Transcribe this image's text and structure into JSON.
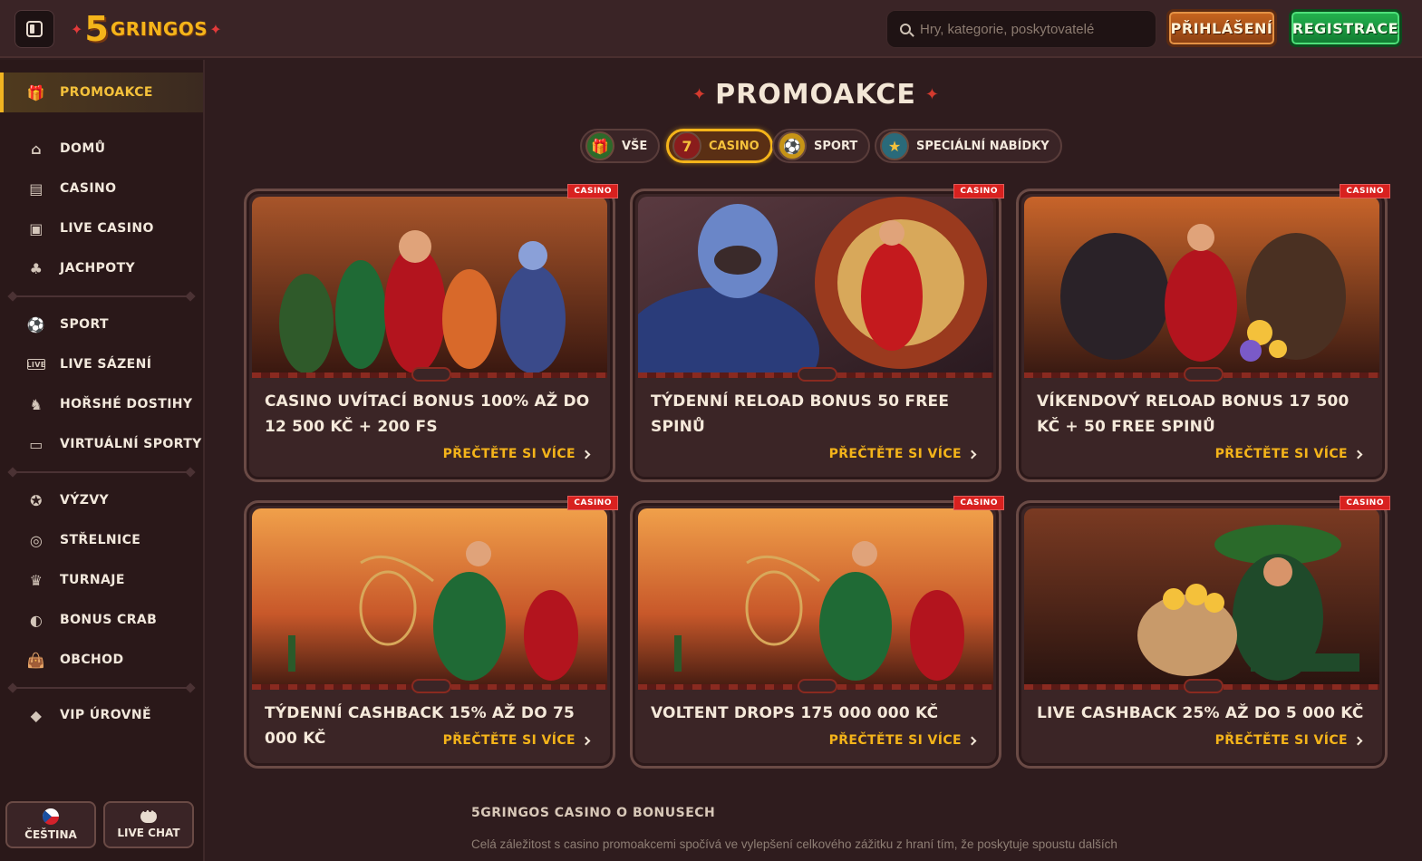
{
  "header": {
    "logo_five": "5",
    "logo_word": "GRINGOS",
    "search_placeholder": "Hry, kategorie, poskytovatelé",
    "login_label": "PŘIHLÁŠENÍ",
    "register_label": "REGISTRACE"
  },
  "sidebar": {
    "active": {
      "label": "PROMOAKCE",
      "icon": "gift-icon"
    },
    "group1": [
      {
        "label": "DOMŮ",
        "icon": "home-icon"
      },
      {
        "label": "CASINO",
        "icon": "slot-machine-icon"
      },
      {
        "label": "LIVE CASINO",
        "icon": "live-casino-icon"
      },
      {
        "label": "JACHPOTY",
        "icon": "clover-icon"
      }
    ],
    "group2": [
      {
        "label": "SPORT",
        "icon": "soccer-ball-icon"
      },
      {
        "label": "LIVE SÁZENÍ",
        "icon": "live-badge-icon"
      },
      {
        "label": "HOŘSHÉ DOSTIHY",
        "icon": "horse-icon"
      },
      {
        "label": "VIRTUÁLNÍ SPORTY",
        "icon": "virtual-sports-icon"
      }
    ],
    "group3": [
      {
        "label": "VÝZVY",
        "icon": "medal-icon"
      },
      {
        "label": "STŘELNICE",
        "icon": "target-icon"
      },
      {
        "label": "TURNAJE",
        "icon": "trophy-icon"
      },
      {
        "label": "BONUS CRAB",
        "icon": "crab-icon"
      },
      {
        "label": "OBCHOD",
        "icon": "shop-bag-icon"
      }
    ],
    "group4": [
      {
        "label": "VIP ÚROVNĚ",
        "icon": "diamond-icon"
      }
    ],
    "language_label": "ČEŠTINA",
    "live_chat_label": "LIVE CHAT"
  },
  "main": {
    "title": "PROMOAKCE",
    "filters": [
      {
        "label": "VŠE",
        "icon": "gift-box-icon",
        "active": false
      },
      {
        "label": "CASINO",
        "icon": "slot-reel-icon",
        "active": true
      },
      {
        "label": "SPORT",
        "icon": "ball-icon",
        "active": false
      },
      {
        "label": "SPECIÁLNÍ NABÍDKY",
        "icon": "star-tag-icon",
        "active": false
      }
    ],
    "tag_label": "CASINO",
    "read_more_label": "PŘEČTĚTE SI VÍCE",
    "cards": [
      {
        "title": "CASINO UVÍTACÍ BONUS 100% AŽ DO 12 500 KČ + 200 FS"
      },
      {
        "title": "TÝDENNÍ RELOAD BONUS 50 FREE SPINŮ"
      },
      {
        "title": "VÍKENDOVÝ RELOAD BONUS 17 500 KČ + 50 FREE SPINŮ"
      },
      {
        "title": "TÝDENNÍ CASHBACK 15% AŽ DO 75 000 KČ"
      },
      {
        "title": "VOLTENT DROPS 175 000 000 KČ"
      },
      {
        "title": "LIVE CASHBACK 25% AŽ DO 5 000 KČ"
      }
    ],
    "seo_title": "5GRINGOS CASINO O BONUSECH",
    "seo_text": "Celá záležitost s casino promoakcemi spočívá ve vylepšení celkového zážitku z hraní tím, že poskytuje spoustu dalších"
  },
  "colors": {
    "accent_gold": "#f4b41a",
    "login_orange": "#c9661f",
    "register_green": "#24b44f",
    "tag_red": "#d8211f",
    "background": "#2f1c1e"
  }
}
